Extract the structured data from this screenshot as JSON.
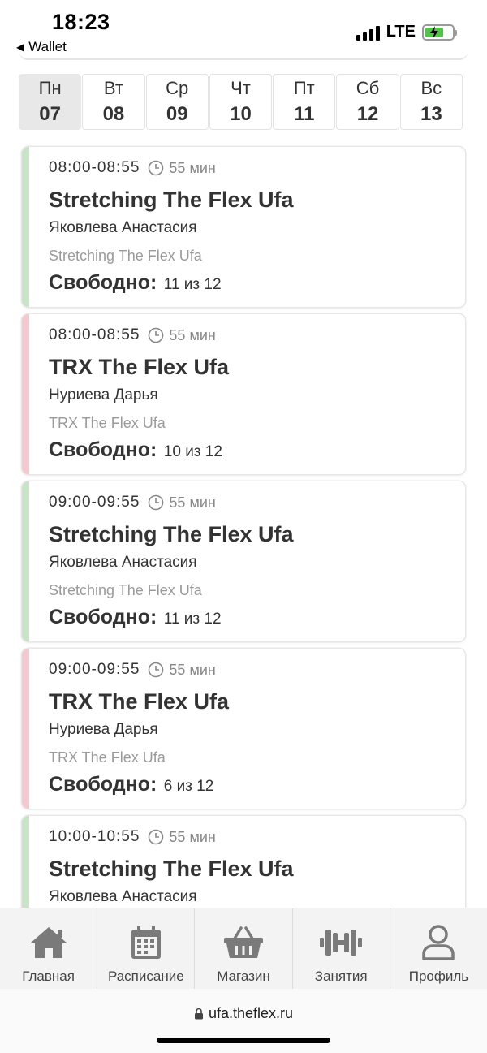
{
  "status_bar": {
    "time": "18:23",
    "back_label": "Wallet",
    "network": "LTE"
  },
  "days": [
    {
      "name": "Пн",
      "num": "07",
      "active": true
    },
    {
      "name": "Вт",
      "num": "08",
      "active": false
    },
    {
      "name": "Ср",
      "num": "09",
      "active": false
    },
    {
      "name": "Чт",
      "num": "10",
      "active": false
    },
    {
      "name": "Пт",
      "num": "11",
      "active": false
    },
    {
      "name": "Сб",
      "num": "12",
      "active": false
    },
    {
      "name": "Вс",
      "num": "13",
      "active": false
    }
  ],
  "sessions": [
    {
      "time": "08:00-08:55",
      "duration": "55 мин",
      "title": "Stretching The Flex Ufa",
      "coach": "Яковлева Анастасия",
      "location": "Stretching The Flex Ufa",
      "free_label": "Свободно:",
      "free_count": "11 из 12",
      "accent": "#c8e3c5"
    },
    {
      "time": "08:00-08:55",
      "duration": "55 мин",
      "title": "TRX The Flex Ufa",
      "coach": "Нуриева Дарья",
      "location": "TRX The Flex Ufa",
      "free_label": "Свободно:",
      "free_count": "10 из 12",
      "accent": "#f5c8cf"
    },
    {
      "time": "09:00-09:55",
      "duration": "55 мин",
      "title": "Stretching The Flex Ufa",
      "coach": "Яковлева Анастасия",
      "location": "Stretching The Flex Ufa",
      "free_label": "Свободно:",
      "free_count": "11 из 12",
      "accent": "#c8e3c5"
    },
    {
      "time": "09:00-09:55",
      "duration": "55 мин",
      "title": "TRX The Flex Ufa",
      "coach": "Нуриева Дарья",
      "location": "TRX The Flex Ufa",
      "free_label": "Свободно:",
      "free_count": "6 из 12",
      "accent": "#f5c8cf"
    },
    {
      "time": "10:00-10:55",
      "duration": "55 мин",
      "title": "Stretching The Flex Ufa",
      "coach": "Яковлева Анастасия",
      "location": "",
      "free_label": "",
      "free_count": "",
      "accent": "#c8e3c5"
    }
  ],
  "nav": [
    {
      "label": "Главная",
      "icon": "home-icon"
    },
    {
      "label": "Расписание",
      "icon": "calendar-icon"
    },
    {
      "label": "Магазин",
      "icon": "basket-icon"
    },
    {
      "label": "Занятия",
      "icon": "dumbbell-icon"
    },
    {
      "label": "Профиль",
      "icon": "profile-icon"
    }
  ],
  "browser": {
    "url": "ufa.theflex.ru"
  }
}
